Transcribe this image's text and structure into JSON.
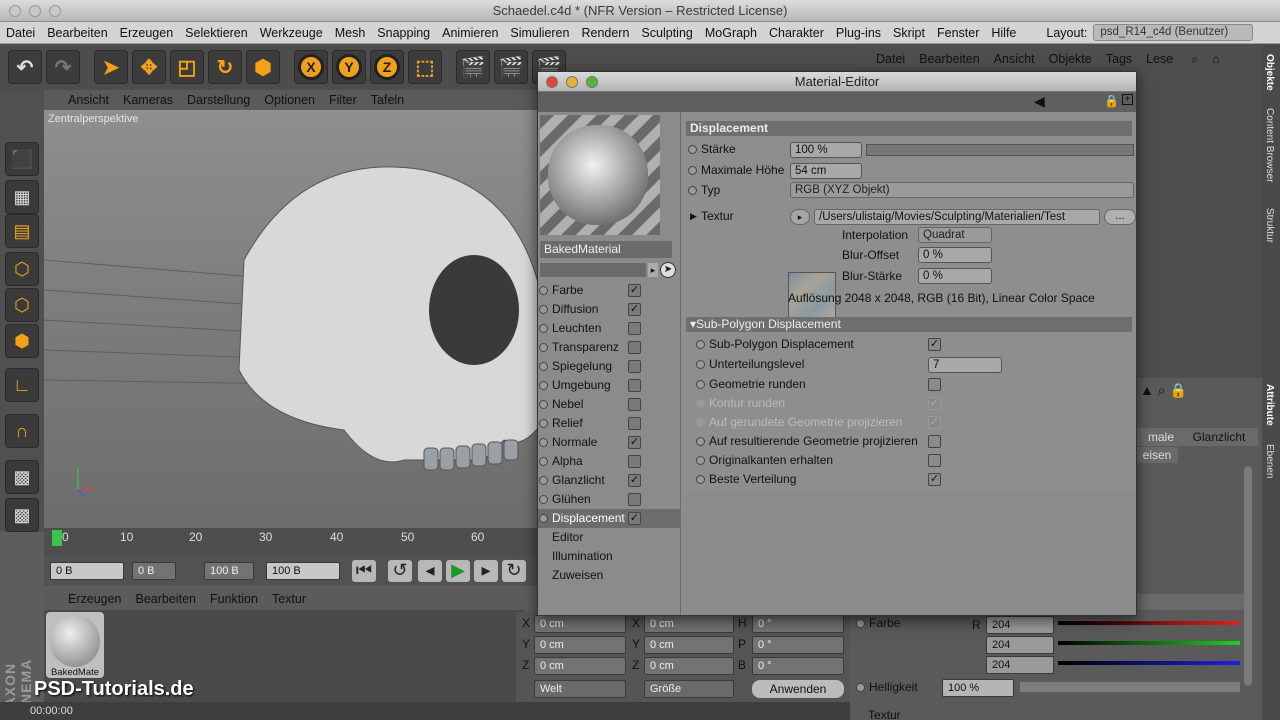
{
  "window_title": "Schaedel.c4d * (NFR Version – Restricted License)",
  "menu": [
    "Datei",
    "Bearbeiten",
    "Erzeugen",
    "Selektieren",
    "Werkzeuge",
    "Mesh",
    "Snapping",
    "Animieren",
    "Simulieren",
    "Rendern",
    "Sculpting",
    "MoGraph",
    "Charakter",
    "Plug-ins",
    "Skript",
    "Fenster",
    "Hilfe"
  ],
  "layout_label": "Layout:",
  "layout_value": "psd_R14_c4d (Benutzer)",
  "object_manager_menu": [
    "Datei",
    "Bearbeiten",
    "Ansicht",
    "Objekte",
    "Tags",
    "Lese"
  ],
  "right_tabs": [
    "Objekte",
    "Content Browser",
    "Struktur",
    "Attribute",
    "Ebenen"
  ],
  "viewport_menu": [
    "Ansicht",
    "Kameras",
    "Darstellung",
    "Optionen",
    "Filter",
    "Tafeln"
  ],
  "viewport_label": "Zentralperspektive",
  "timeline_ticks": [
    "0",
    "10",
    "20",
    "30",
    "40",
    "50",
    "60"
  ],
  "timeline": {
    "start": "0 B",
    "range_start": "0 B",
    "range_end": "100 B",
    "end": "100 B"
  },
  "material_manager_menu": [
    "Erzeugen",
    "Bearbeiten",
    "Funktion",
    "Textur"
  ],
  "material_thumb_label": "BakedMate",
  "coord": {
    "labels": [
      "X",
      "Y",
      "Z",
      "X",
      "Y",
      "Z",
      "H",
      "P",
      "B"
    ],
    "values": [
      "0 cm",
      "0 cm",
      "0 cm",
      "0 cm",
      "0 cm",
      "0 cm",
      "0 °",
      "0 °",
      "0 °"
    ],
    "world": "Welt",
    "size": "Größe",
    "apply": "Anwenden"
  },
  "attr": {
    "tabs": [
      "male",
      "Glanzlicht",
      "eisen"
    ],
    "farbe_label": "Farbe",
    "rgb": [
      {
        "label": "R",
        "value": "204"
      },
      {
        "label": "G",
        "value": "204"
      },
      {
        "label": "B",
        "value": "204"
      }
    ],
    "helligkeit_label": "Helligkeit",
    "helligkeit_value": "100 %",
    "textur_label": "Textur"
  },
  "status_time": "00:00:00",
  "logo_text": "PSD-Tutorials.de",
  "maxon_text": "MAXON CINEMA 4D",
  "material_editor": {
    "title": "Material-Editor",
    "material_name": "BakedMaterial",
    "channels": [
      {
        "label": "Farbe",
        "checked": true
      },
      {
        "label": "Diffusion",
        "checked": true
      },
      {
        "label": "Leuchten",
        "checked": false
      },
      {
        "label": "Transparenz",
        "checked": false
      },
      {
        "label": "Spiegelung",
        "checked": false
      },
      {
        "label": "Umgebung",
        "checked": false
      },
      {
        "label": "Nebel",
        "checked": false
      },
      {
        "label": "Relief",
        "checked": false
      },
      {
        "label": "Normale",
        "checked": true
      },
      {
        "label": "Alpha",
        "checked": false
      },
      {
        "label": "Glanzlicht",
        "checked": true
      },
      {
        "label": "Glühen",
        "checked": false
      },
      {
        "label": "Displacement",
        "checked": true
      }
    ],
    "extra_items": [
      "Editor",
      "Illumination",
      "Zuweisen"
    ],
    "section_title": "Displacement",
    "staerke_label": "Stärke",
    "staerke_value": "100 %",
    "max_hoehe_label": "Maximale Höhe",
    "max_hoehe_value": "54 cm",
    "typ_label": "Typ",
    "typ_value": "RGB (XYZ Objekt)",
    "textur_label": "Textur",
    "textur_path": "/Users/ulistaig/Movies/Sculpting/Materialien/Test",
    "textur_more": "...",
    "interpolation_label": "Interpolation",
    "interpolation_value": "Quadrat",
    "blur_offset_label": "Blur-Offset",
    "blur_offset_value": "0 %",
    "blur_staerke_label": "Blur-Stärke",
    "blur_staerke_value": "0 %",
    "resolution": "Auflösung 2048 x 2048, RGB (16 Bit), Linear Color Space",
    "subpoly_section": "Sub-Polygon Displacement",
    "subpoly_rows": [
      {
        "label": "Sub-Polygon Displacement",
        "checked": true,
        "dim": false
      },
      {
        "label": "Unterteilungslevel",
        "value": "7",
        "dim": false
      },
      {
        "label": "Geometrie runden",
        "checked": false,
        "dim": false
      },
      {
        "label": "Kontur runden",
        "checked": true,
        "dim": true
      },
      {
        "label": "Auf gerundete Geometrie projizieren",
        "checked": true,
        "dim": true
      },
      {
        "label": "Auf resultierende Geometrie projizieren",
        "checked": false,
        "dim": false
      },
      {
        "label": "Originalkanten erhalten",
        "checked": false,
        "dim": false
      },
      {
        "label": "Beste Verteilung",
        "checked": true,
        "dim": false
      }
    ]
  }
}
